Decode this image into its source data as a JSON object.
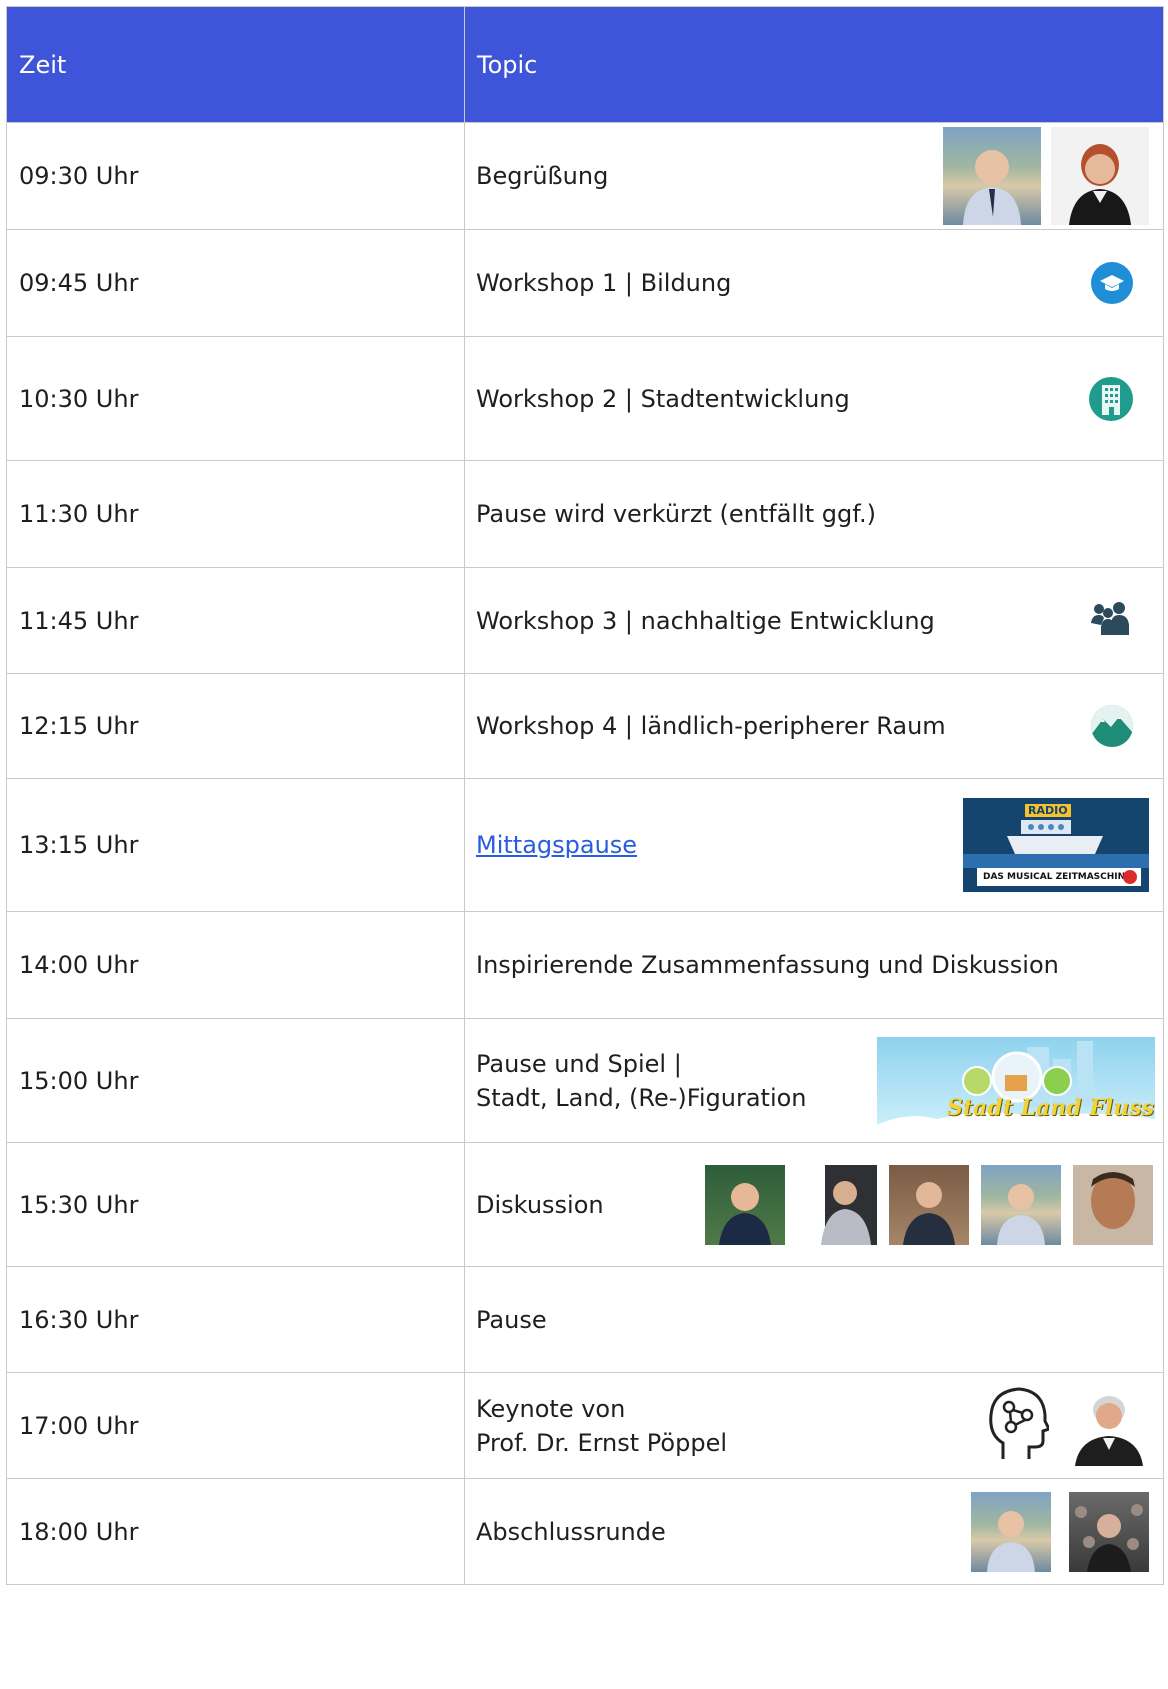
{
  "table": {
    "header": {
      "time": "Zeit",
      "topic": "Topic"
    },
    "rows": [
      {
        "time": "09:30 Uhr",
        "topic": "Begrüßung"
      },
      {
        "time": "09:45 Uhr",
        "topic": "Workshop 1 | Bildung",
        "icon": "graduation-cap-icon"
      },
      {
        "time": "10:30 Uhr",
        "topic": "Workshop 2 | Stadtentwicklung",
        "icon": "building-icon"
      },
      {
        "time": "11:30 Uhr",
        "topic": "Pause wird verkürzt (entfällt ggf.)"
      },
      {
        "time": "11:45 Uhr",
        "topic": "Workshop 3 | nachhaltige Entwicklung",
        "icon": "users-icon"
      },
      {
        "time": "12:15 Uhr",
        "topic": "Workshop 4 | ländlich-peripherer Raum",
        "icon": "mountain-icon"
      },
      {
        "time": "13:15 Uhr",
        "topic": "Mittagspause",
        "banner": {
          "top": "RADIO",
          "bottom": "DAS MUSICAL ZEITMASCHINE"
        }
      },
      {
        "time": "14:00 Uhr",
        "topic": "Inspirierende Zusammenfassung und Diskussion"
      },
      {
        "time": "15:00 Uhr",
        "topic_line1": "Pause und Spiel |",
        "topic_line2": "Stadt, Land, (Re-)Figuration",
        "game_banner": "Stadt Land Fluss"
      },
      {
        "time": "15:30 Uhr",
        "topic": "Diskussion"
      },
      {
        "time": "16:30 Uhr",
        "topic": "Pause"
      },
      {
        "time": "17:00 Uhr",
        "topic_line1": "Keynote von",
        "topic_line2": "Prof. Dr. Ernst Pöppel",
        "icon": "brain-head-icon"
      },
      {
        "time": "18:00 Uhr",
        "topic": "Abschlussrunde"
      }
    ]
  },
  "colors": {
    "header_bg": "#3f55d9",
    "grid": "#c9c9c9",
    "link": "#2a5ce0",
    "icon_blue": "#1e8fd6",
    "icon_teal": "#1f9c8c"
  }
}
